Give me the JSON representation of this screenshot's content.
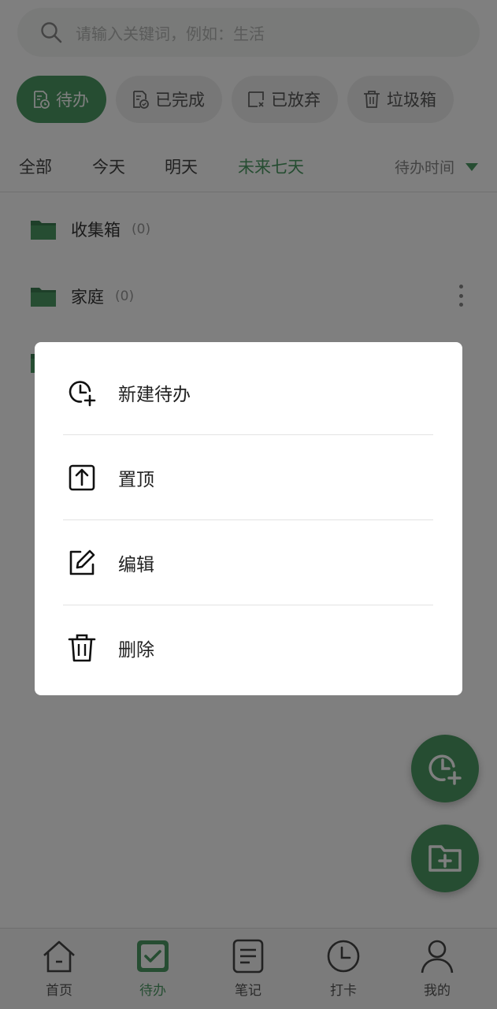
{
  "search": {
    "placeholder": "请输入关键词，例如：生活",
    "icon": "search-icon"
  },
  "chips": [
    {
      "label": "待办",
      "icon": "todo-doc-icon",
      "active": true
    },
    {
      "label": "已完成",
      "icon": "done-doc-icon"
    },
    {
      "label": "已放弃",
      "icon": "abandon-icon"
    },
    {
      "label": "垃圾箱",
      "icon": "trash-icon"
    }
  ],
  "filters": {
    "all": "全部",
    "today": "今天",
    "tomorrow": "明天",
    "next7": "未来七天",
    "sort": "待办时间"
  },
  "folders": [
    {
      "name": "收集箱",
      "count": "(0)"
    },
    {
      "name": "家庭",
      "count": "(0)"
    }
  ],
  "menu": {
    "new_todo": "新建待办",
    "pin_top": "置顶",
    "edit": "编辑",
    "delete": "删除"
  },
  "nav": {
    "home": "首页",
    "todo": "待办",
    "notes": "笔记",
    "checkin": "打卡",
    "mine": "我的"
  },
  "colors": {
    "accent": "#4d9a64",
    "overlay": "rgba(0,0,0,0.5)"
  }
}
